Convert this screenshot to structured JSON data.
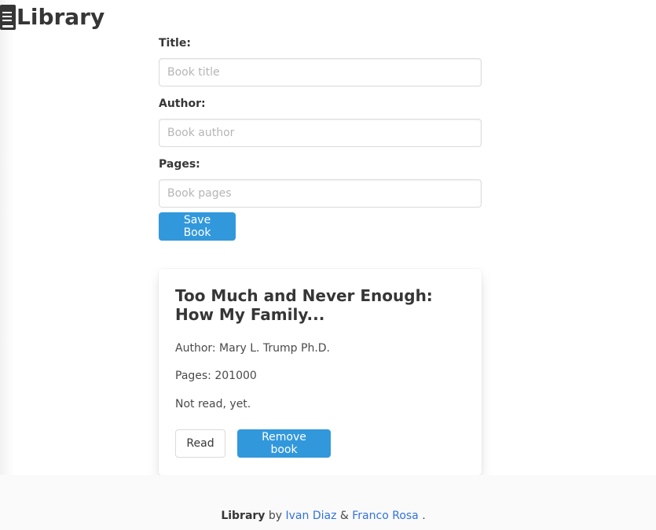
{
  "app": {
    "title": "Library"
  },
  "form": {
    "title_label": "Title:",
    "title_placeholder": "Book title",
    "author_label": "Author:",
    "author_placeholder": "Book author",
    "pages_label": "Pages:",
    "pages_placeholder": "Book pages",
    "save_label": "Save Book"
  },
  "books": [
    {
      "title": "Too Much and Never Enough: How My Family...",
      "author_text": "Author: Mary L. Trump Ph.D.",
      "pages_text": "Pages: 201000",
      "status_text": "Not read, yet.",
      "read_label": "Read",
      "remove_label": "Remove book"
    }
  ],
  "footer": {
    "brand": "Library",
    "by": "by",
    "author1": "Ivan Diaz",
    "amp": "&",
    "author2": "Franco Rosa",
    "end": "."
  }
}
